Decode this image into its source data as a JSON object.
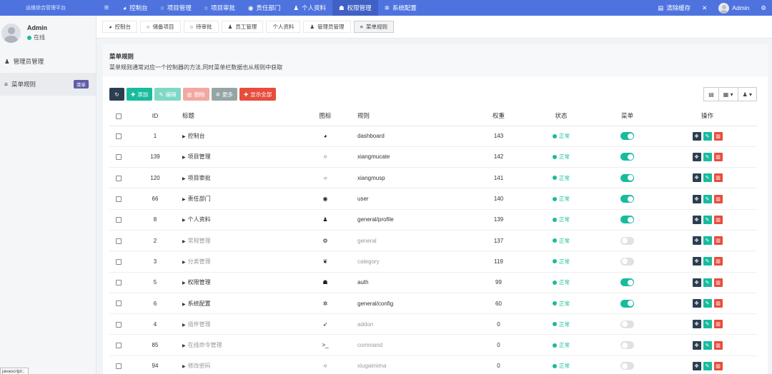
{
  "brand": "运维综合管理平台",
  "topnav": [
    {
      "label": "控制台",
      "icon": "dashboard-icon",
      "glyph": "◕",
      "active": false
    },
    {
      "label": "项目管理",
      "icon": "circle-icon",
      "glyph": "○",
      "active": false
    },
    {
      "label": "项目审批",
      "icon": "circle-icon",
      "glyph": "○",
      "active": false
    },
    {
      "label": "责任部门",
      "icon": "user-circle-icon",
      "glyph": "◉",
      "active": false
    },
    {
      "label": "个人资料",
      "icon": "user-icon",
      "glyph": "♟",
      "active": false
    },
    {
      "label": "权限管理",
      "icon": "group-icon",
      "glyph": "☗",
      "active": true
    },
    {
      "label": "系统配置",
      "icon": "gear-icon",
      "glyph": "✲",
      "active": false
    }
  ],
  "topright": {
    "clear_cache": "清除缓存",
    "admin": "Admin"
  },
  "sidebar": {
    "user_name": "Admin",
    "user_status": "在线",
    "items": [
      {
        "label": "管理员管理",
        "glyph": "♟",
        "badge": "",
        "active": false
      },
      {
        "label": "菜单规则",
        "glyph": "≡",
        "badge": "菜单",
        "active": true
      }
    ]
  },
  "tabs": [
    {
      "label": "控制台",
      "glyph": "◕",
      "active": false
    },
    {
      "label": "储备项目",
      "glyph": "○",
      "active": false
    },
    {
      "label": "待审批",
      "glyph": "○",
      "active": false
    },
    {
      "label": "员工管理",
      "glyph": "♟",
      "active": false
    },
    {
      "label": "个人资料",
      "glyph": "",
      "active": false
    },
    {
      "label": "管理员管理",
      "glyph": "♟",
      "active": false
    },
    {
      "label": "菜单规则",
      "glyph": "≡",
      "active": true
    }
  ],
  "panel": {
    "title": "菜单规则",
    "description": "菜单规则通常对应一个控制器的方法,同时菜单栏数据也从规则中获取"
  },
  "toolbar": {
    "add": "添加",
    "edit": "编辑",
    "delete": "删除",
    "more": "更多",
    "show_all": "显示全部"
  },
  "table": {
    "headers": {
      "id": "ID",
      "title": "标题",
      "icon": "图标",
      "rule": "规则",
      "weigh": "权重",
      "status": "状态",
      "menu": "菜单",
      "operate": "操作"
    },
    "rows": [
      {
        "id": "1",
        "title": "控制台",
        "glyph": "◕",
        "icon_name": "dashboard-icon",
        "rule": "dashboard",
        "weigh": "143",
        "status": "正常",
        "menu": true
      },
      {
        "id": "139",
        "title": "项目管理",
        "glyph": "○",
        "icon_name": "circle-icon",
        "rule": "xiangmucate",
        "weigh": "142",
        "status": "正常",
        "menu": true
      },
      {
        "id": "120",
        "title": "项目审批",
        "glyph": "○",
        "icon_name": "circle-icon",
        "rule": "xiangmusp",
        "weigh": "141",
        "status": "正常",
        "menu": true
      },
      {
        "id": "66",
        "title": "责任部门",
        "glyph": "◉",
        "icon_name": "user-circle-icon",
        "rule": "user",
        "weigh": "140",
        "status": "正常",
        "menu": true
      },
      {
        "id": "8",
        "title": "个人资料",
        "glyph": "♟",
        "icon_name": "user-icon",
        "rule": "general/profile",
        "weigh": "139",
        "status": "正常",
        "menu": true
      },
      {
        "id": "2",
        "title": "常规管理",
        "glyph": "⚙",
        "icon_name": "cogs-icon",
        "rule": "general",
        "weigh": "137",
        "status": "正常",
        "menu": false
      },
      {
        "id": "3",
        "title": "分类管理",
        "glyph": "❦",
        "icon_name": "leaf-icon",
        "rule": "category",
        "weigh": "119",
        "status": "正常",
        "menu": false
      },
      {
        "id": "5",
        "title": "权限管理",
        "glyph": "☗",
        "icon_name": "group-icon",
        "rule": "auth",
        "weigh": "99",
        "status": "正常",
        "menu": true
      },
      {
        "id": "6",
        "title": "系统配置",
        "glyph": "✲",
        "icon_name": "gear-icon",
        "rule": "general/config",
        "weigh": "60",
        "status": "正常",
        "menu": true
      },
      {
        "id": "4",
        "title": "插件管理",
        "glyph": "➶",
        "icon_name": "rocket-icon",
        "rule": "addon",
        "weigh": "0",
        "status": "正常",
        "menu": false
      },
      {
        "id": "85",
        "title": "在线命令管理",
        "glyph": ">_",
        "icon_name": "terminal-icon",
        "rule": "command",
        "weigh": "0",
        "status": "正常",
        "menu": false
      },
      {
        "id": "94",
        "title": "修改密码",
        "glyph": "○",
        "icon_name": "circle-icon",
        "rule": "xiugaimima",
        "weigh": "0",
        "status": "正常",
        "menu": false
      }
    ]
  },
  "tooltip": "javascript:;"
}
